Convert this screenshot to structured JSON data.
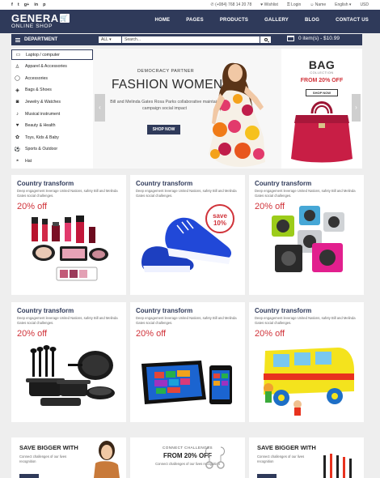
{
  "topbar": {
    "social": [
      "f",
      "t",
      "g+",
      "in",
      "p"
    ],
    "phone": "(+084) 768 14 20 78",
    "wishlist": "Wishlist",
    "login": "Login",
    "name": "Name",
    "language": "English ▾",
    "currency": "USD"
  },
  "header": {
    "logo_main": "GENERA",
    "logo_sub": "ONLINE SHOP",
    "nav": [
      "HOME",
      "PAGES",
      "PRODUCTS",
      "GALLERY",
      "BLOG",
      "CONTACT US"
    ]
  },
  "department": {
    "label": "DEPARTMENT"
  },
  "search": {
    "category": "ALL ▾",
    "placeholder": "Search...",
    "cart_text": "0 item(s) - $10.99"
  },
  "categories": [
    {
      "label": "Laptop / computer",
      "icon": "laptop-icon",
      "glyph": "▭"
    },
    {
      "label": "Apparel & Accessories",
      "icon": "shirt-icon",
      "glyph": "♙"
    },
    {
      "label": "Accessories",
      "icon": "ring-icon",
      "glyph": "◯"
    },
    {
      "label": "Bags & Shoes",
      "icon": "bag-icon",
      "glyph": "◈"
    },
    {
      "label": "Jewelry & Watches",
      "icon": "watch-icon",
      "glyph": "◙"
    },
    {
      "label": "Musical instrument",
      "icon": "guitar-icon",
      "glyph": "♪"
    },
    {
      "label": "Beauty & Health",
      "icon": "heart-icon",
      "glyph": "♥"
    },
    {
      "label": "Toys, Kids & Baby",
      "icon": "toy-icon",
      "glyph": "✿"
    },
    {
      "label": "Sports & Outdoor",
      "icon": "ball-icon",
      "glyph": "⚽"
    },
    {
      "label": "Hat",
      "icon": "hat-icon",
      "glyph": "◓"
    }
  ],
  "hero": {
    "partner": "DEMOCRACY PARTNER",
    "title": "FASHION WOMEN",
    "desc": "Bill and Melinda Gates Rosa Parks collaborative maintain campaign social impact",
    "shop_now": "SHOP NOW",
    "prev": "‹"
  },
  "promo": {
    "title": "BAG",
    "sub": "COLLECTION",
    "offer": "FROM 20% OFF",
    "button": "SHOP NOW",
    "next": "›"
  },
  "products": [
    {
      "title": "Country transform",
      "desc": "Deep engagement leverage United Nations, safety Bill and Melinda Gates social challenges.",
      "discount": "20% off"
    },
    {
      "title": "Country transform",
      "desc": "Deep engagement leverage United Nations, safety Bill and Melinda Gates social challenges.",
      "discount": "",
      "badge_top": "save",
      "badge_bottom": "10%"
    },
    {
      "title": "Country transform",
      "desc": "Deep engagement leverage United Nations, safety Bill and Melinda Gates social challenges.",
      "discount": "20% off"
    },
    {
      "title": "Country transform",
      "desc": "Deep engagement leverage United Nations, safety Bill and Melinda Gates social challenges.",
      "discount": "20% off"
    },
    {
      "title": "Country transform",
      "desc": "Deep engagement leverage United Nations, safety Bill and Melinda Gates social challenges.",
      "discount": "20% off"
    },
    {
      "title": "Country transform",
      "desc": "Deep engagement leverage United Nations, safety Bill and Melinda Gates social challenges.",
      "discount": "20% off"
    }
  ],
  "banners": [
    {
      "title": "SAVE BIGGER WITH",
      "desc": "Connect challenges of our lives recognition"
    },
    {
      "kicker": "CONNECT CHALLENGES",
      "title": "FROM 20% OFF",
      "desc": "Connect challenges of our lives recognition"
    },
    {
      "title": "SAVE BIGGER WITH",
      "desc": "Connect challenges of our lives recognition"
    }
  ],
  "colors": {
    "navy": "#2f3a5a",
    "accent_red": "#d0333a",
    "page_bg": "#eeeeee"
  }
}
